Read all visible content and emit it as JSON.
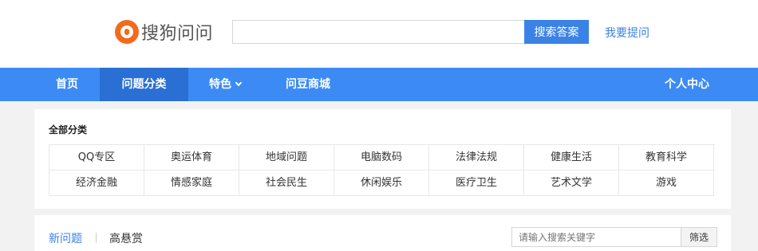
{
  "header": {
    "logo_text": "搜狗问问",
    "search": {
      "value": "",
      "placeholder": ""
    },
    "search_button": "搜索答案",
    "ask_link": "我要提问"
  },
  "nav": {
    "items": [
      {
        "label": "首页"
      },
      {
        "label": "问题分类",
        "active": true
      },
      {
        "label": "特色",
        "has_dropdown": true
      },
      {
        "label": "问豆商城"
      }
    ],
    "user_center": "个人中心"
  },
  "categories": {
    "title": "全部分类",
    "items": [
      "QQ专区",
      "奥运体育",
      "地域问题",
      "电脑数码",
      "法律法规",
      "健康生活",
      "教育科学",
      "经济金融",
      "情感家庭",
      "社会民生",
      "休闲娱乐",
      "医疗卫生",
      "艺术文学",
      "游戏"
    ]
  },
  "questions": {
    "tabs": [
      {
        "label": "新问题",
        "active": true
      },
      {
        "label": "高悬赏"
      }
    ],
    "filter": {
      "placeholder": "请输入搜索关键字",
      "value": ""
    },
    "filter_button": "筛选"
  },
  "colors": {
    "brand_blue": "#3c8bf4",
    "nav_active": "#2a6fd4",
    "logo_orange": "#f26b1d"
  }
}
